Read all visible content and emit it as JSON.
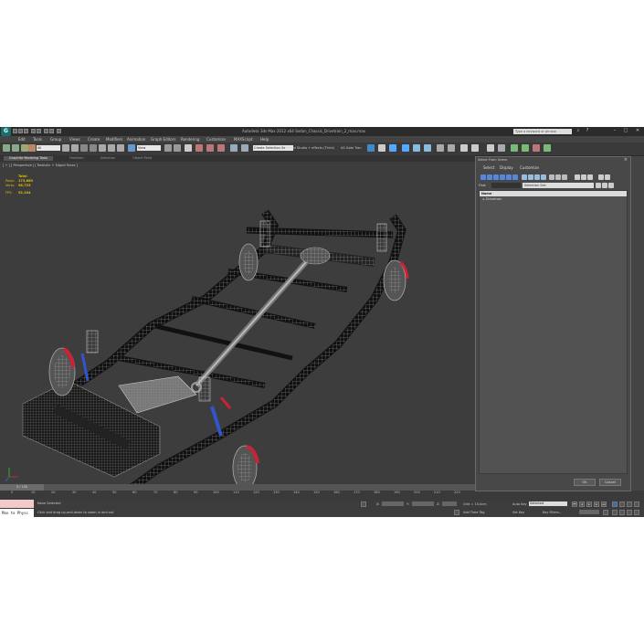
{
  "window": {
    "title": "Autodesk 3ds Max 2012 x64    Sedan_Chassis_Drivetrain_2_max.max",
    "search_placeholder": "Type a keyword or phrase",
    "app_logo": "3ds-max-logo"
  },
  "menu": [
    "Edit",
    "Tools",
    "Group",
    "Views",
    "Create",
    "Modifiers",
    "Animation",
    "Graph Editors",
    "Rendering",
    "Customize",
    "MAXScript",
    "Help"
  ],
  "toolbar": {
    "selection_filter": "All",
    "reference_coord": "View",
    "named_selection": "Create Selection Se",
    "snap_text": "Equal Studio + effects (Thick)",
    "dot_text": "AS Gate Tran"
  },
  "ribbon": {
    "tabs": [
      "Graphite Modeling Tools",
      "Freeform",
      "Selection",
      "Object Paint"
    ],
    "active_tab": 0
  },
  "viewport": {
    "label": "[ + ] [ Perspective ] [ Realistic + Edged Faces ]",
    "stats": {
      "total_label": "Total",
      "polys_label": "Polys:",
      "polys": "173,680",
      "verts_label": "Verts:",
      "verts": "98,725",
      "fps_label": "FPS:",
      "fps": "92,104"
    }
  },
  "timeline": {
    "slider_label": "0 / 100",
    "ticks": [
      "0",
      "10",
      "20",
      "30",
      "40",
      "50",
      "60",
      "70",
      "80",
      "90",
      "100",
      "110",
      "120",
      "130",
      "140",
      "150",
      "160",
      "170",
      "180",
      "190",
      "200",
      "210",
      "220"
    ]
  },
  "status": {
    "listener_text": "Max to Physc",
    "selection_status": "None Selected",
    "prompt": "Click and drag up-and-down to zoom in and out",
    "x_label": "X:",
    "y_label": "Y:",
    "z_label": "Z:",
    "grid": "Grid = 10,0cm",
    "add_time_tag": "Add Time Tag",
    "auto_key": "Auto Key",
    "auto_key_mode": "Selected",
    "set_key": "Set Key",
    "key_filters": "Key Filters..."
  },
  "dialog": {
    "title": "Select From Scene",
    "menus": [
      "Select",
      "Display",
      "Customize"
    ],
    "find_label": "Find:",
    "selection_set": "Selection Set:",
    "column_header": "Name",
    "items": [
      "Drivetrain"
    ],
    "ok_label": "OK",
    "cancel_label": "Cancel"
  },
  "colors": {
    "viewport_bg": "#3d3d3d",
    "stats_text": "#e0c000",
    "accent_teal": "#1a6d6d",
    "brake_red": "#cc2233",
    "spring_blue": "#3355cc"
  }
}
